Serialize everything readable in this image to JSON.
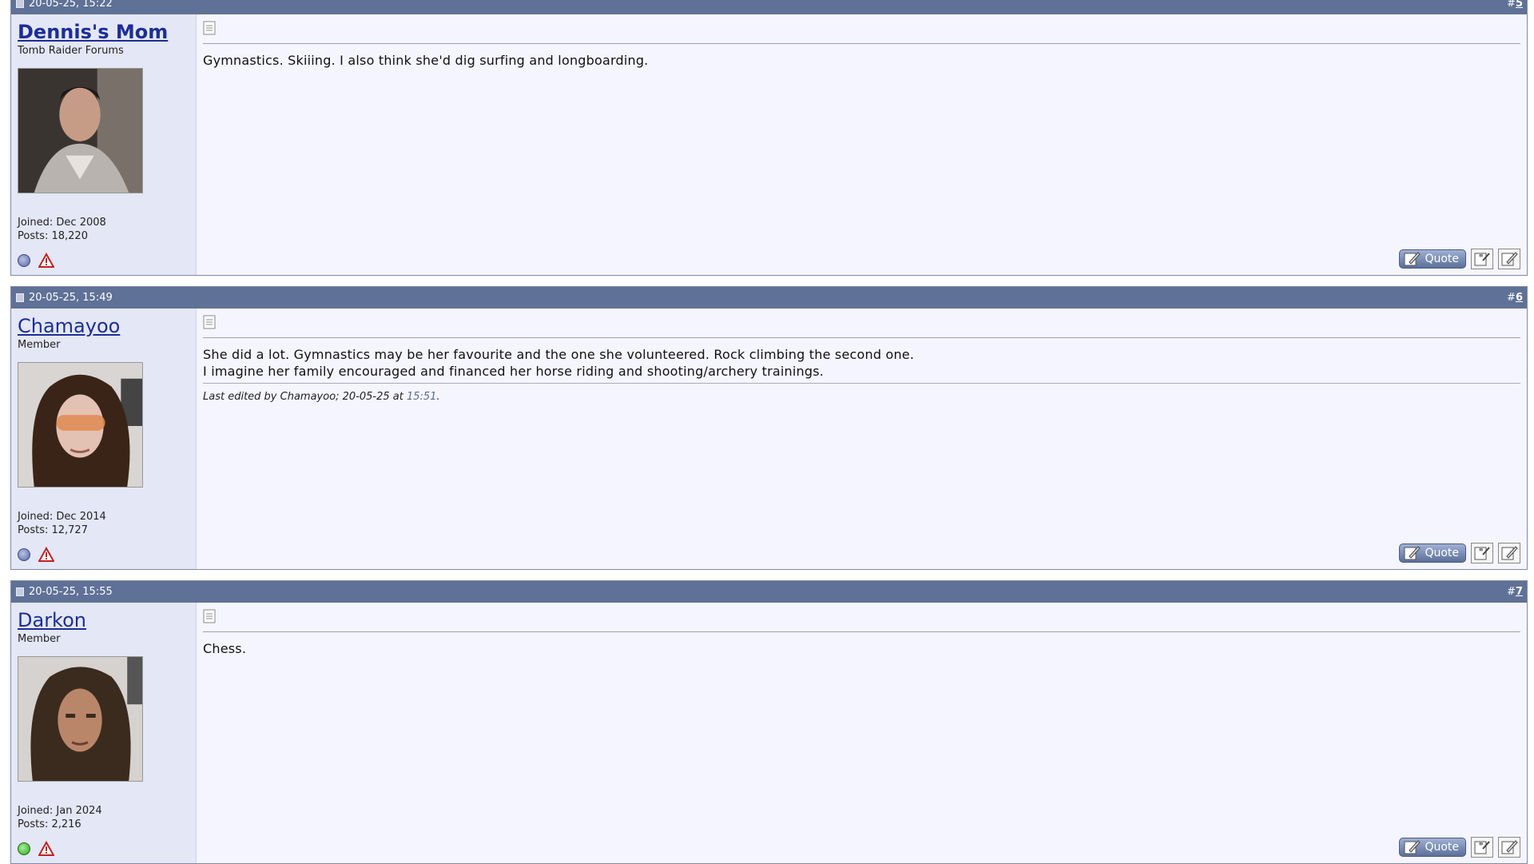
{
  "posts": [
    {
      "date": "20-05-25, 15:22",
      "num_prefix": "#",
      "num": "5",
      "username": "Dennis's Mom",
      "usertitle": "Tomb Raider Forums",
      "joined": "Joined: Dec 2008",
      "posts": "Posts: 18,220",
      "online": false,
      "message": [
        "Gymnastics. Skiiing. I also think she'd dig surfing and longboarding."
      ],
      "quote_label": "Quote"
    },
    {
      "date": "20-05-25, 15:49",
      "num_prefix": "#",
      "num": "6",
      "username": "Chamayoo",
      "usertitle": "Member",
      "joined": "Joined: Dec 2014",
      "posts": "Posts: 12,727",
      "online": false,
      "message": [
        "She did a lot. Gymnastics may be her favourite and the one she volunteered. Rock climbing the second one.",
        "I imagine her family encouraged and financed her horse riding and shooting/archery trainings."
      ],
      "edited_prefix": "Last edited by Chamayoo; 20-05-25 at ",
      "edited_time": "15:51",
      "edited_suffix": ".",
      "quote_label": "Quote"
    },
    {
      "date": "20-05-25, 15:55",
      "num_prefix": "#",
      "num": "7",
      "username": "Darkon",
      "usertitle": "Member",
      "joined": "Joined: Jan 2024",
      "posts": "Posts: 2,216",
      "online": true,
      "message": [
        "Chess."
      ],
      "quote_label": "Quote"
    }
  ],
  "colors": {
    "header_bg": "#5f7196",
    "userinfo_bg": "#e4e7f6",
    "content_bg": "#f5f5ff",
    "username": "#1c2e97"
  },
  "icons": {
    "status_offline": "status-offline-icon",
    "status_online": "status-online-icon",
    "report": "report-warning-icon",
    "post_doc": "document-icon",
    "multiquote": "multi-quote-icon",
    "reply": "reply-edit-icon"
  }
}
